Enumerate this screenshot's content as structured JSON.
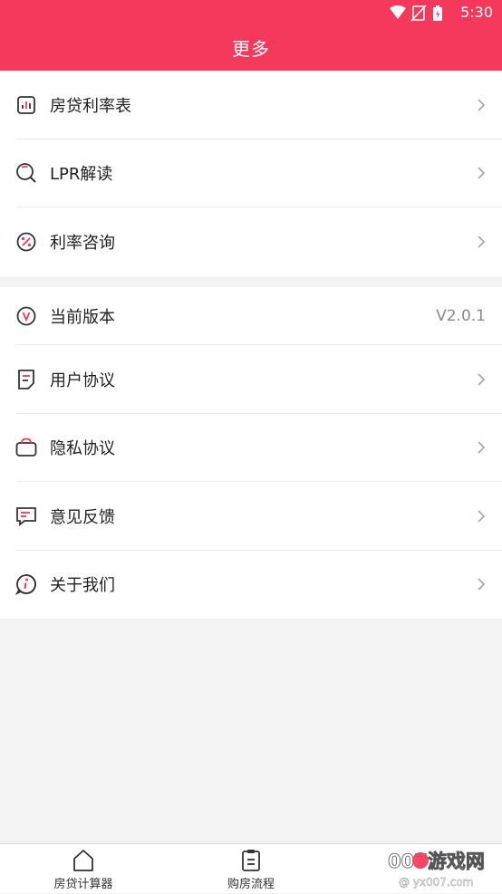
{
  "status": {
    "time": "5:30"
  },
  "header": {
    "title": "更多"
  },
  "section1": [
    {
      "label": "房贷利率表",
      "icon": "bar-chart-icon"
    },
    {
      "label": "LPR解读",
      "icon": "search-icon"
    },
    {
      "label": "利率咨询",
      "icon": "percent-icon"
    }
  ],
  "section2": [
    {
      "label": "当前版本",
      "value": "V2.0.1",
      "icon": "version-icon"
    },
    {
      "label": "用户协议",
      "icon": "document-icon"
    },
    {
      "label": "隐私协议",
      "icon": "bag-icon"
    },
    {
      "label": "意见反馈",
      "icon": "feedback-icon"
    },
    {
      "label": "关于我们",
      "icon": "info-icon"
    }
  ],
  "bottom_nav": [
    {
      "label": "房贷计算器",
      "icon": "home-icon"
    },
    {
      "label": "购房流程",
      "icon": "clipboard-icon"
    }
  ],
  "watermark": {
    "text": "007游戏网",
    "subtext": "@ yx007.com"
  },
  "colors": {
    "accent": "#f5395c",
    "icon_dark": "#333333",
    "icon_accent": "#f5395c"
  }
}
